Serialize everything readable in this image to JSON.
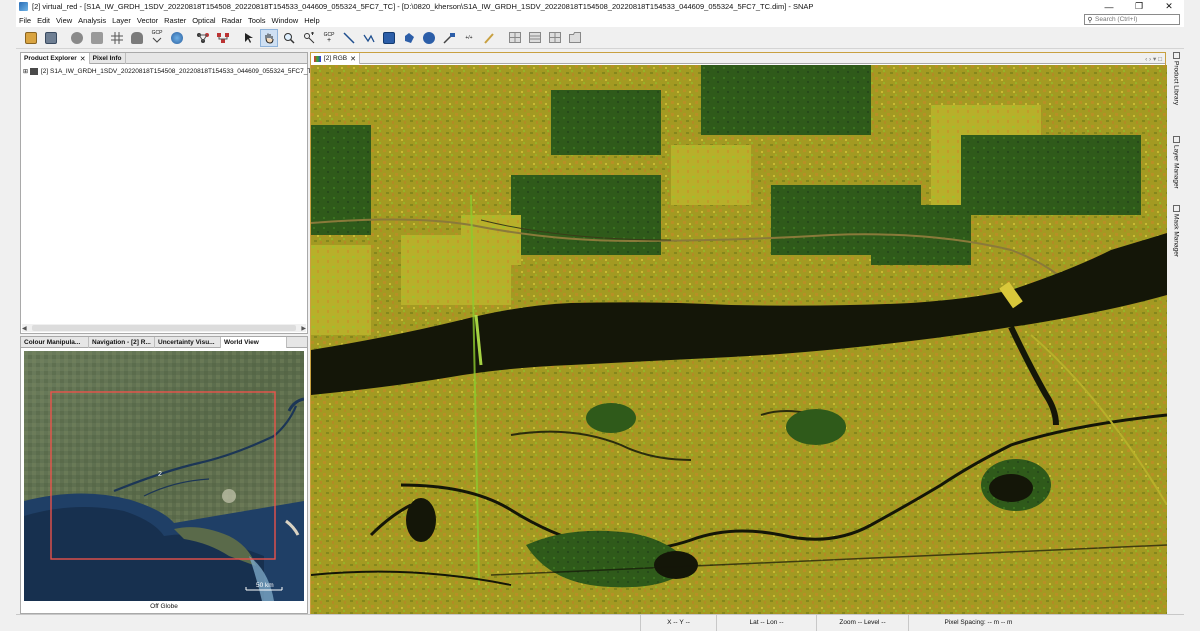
{
  "window": {
    "title": "[2] virtual_red - [S1A_IW_GRDH_1SDV_20220818T154508_20220818T154533_044609_055324_5FC7_TC] - [D:\\0820_kherson\\S1A_IW_GRDH_1SDV_20220818T154508_20220818T154533_044609_055324_5FC7_TC.dim] - SNAP",
    "minimize": "—",
    "restore": "❐",
    "close": "✕"
  },
  "menu": [
    "File",
    "Edit",
    "View",
    "Analysis",
    "Layer",
    "Vector",
    "Raster",
    "Optical",
    "Radar",
    "Tools",
    "Window",
    "Help"
  ],
  "search": {
    "placeholder": "Search (Ctrl+I)"
  },
  "toolbar": {
    "icons": [
      "open-product-icon",
      "save-product-icon",
      "graph-builder-icon",
      "batch-processing-icon",
      "grid-icon",
      "time-series-icon",
      "gcp-icon",
      "world-map-icon",
      "range-finder-icon",
      "mask-icon",
      "select-tool-icon",
      "pan-tool-icon",
      "zoom-tool-icon",
      "pin-tool-icon",
      "gcp-tool-icon",
      "line-draw-icon",
      "polyline-draw-icon",
      "rectangle-draw-icon",
      "polygon-draw-icon",
      "ellipse-draw-icon",
      "magic-wand-icon",
      "pixel-info-icon",
      "ruler-icon",
      "tile-horizontal-icon",
      "tile-vertical-icon",
      "tile-evenly-icon",
      "tile-single-icon"
    ],
    "active_icon": "pan-tool-icon",
    "gcp_label": "GCP"
  },
  "explorer": {
    "tabs": [
      {
        "label": "Product Explorer",
        "close": "✕"
      },
      {
        "label": "Pixel Info"
      }
    ],
    "product": "[2] S1A_IW_GRDH_1SDV_20220818T154508_20220818T154533_044609_055324_5FC7_TC"
  },
  "tool_panel": {
    "tabs": [
      "Colour Manipula...",
      "Navigation - [2] R...",
      "Uncertainty Visu...",
      "World View"
    ],
    "map_label": "2",
    "scale_label": "50 km",
    "footer": "Off Globe"
  },
  "image_window": {
    "tab": "[2] RGB",
    "close": "✕"
  },
  "right_tabs": [
    "Product Library",
    "Layer Manager",
    "Mask Manager"
  ],
  "status": {
    "x_label": "X",
    "x": "--",
    "y_label": "Y",
    "y": "--",
    "lat_label": "Lat",
    "lat": "--",
    "lon_label": "Lon",
    "lon": "--",
    "zoom_label": "Zoom",
    "zoom": "--",
    "level_label": "Level",
    "level": "--",
    "pixel_spacing_label": "Pixel Spacing:",
    "pixel_spacing": "-- m -- m"
  },
  "colors": {
    "field_yellow": "#b5a323",
    "field_green": "#2f5a1a",
    "bright_green": "#8ccb2e",
    "water": "#141608",
    "footprint_red": "#e8524a",
    "sea_blue": "#1f3f66"
  }
}
